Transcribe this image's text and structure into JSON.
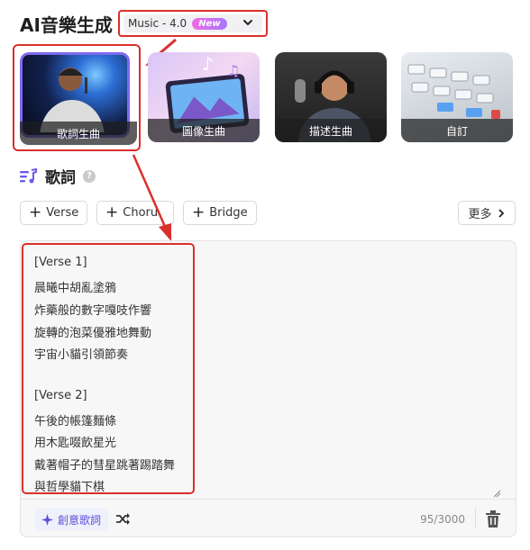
{
  "header": {
    "title": "AI音樂生成",
    "model_select": {
      "label": "Music - 4.0",
      "badge": "New"
    }
  },
  "modes": [
    {
      "label": "歌詞生曲",
      "selected": true
    },
    {
      "label": "圖像生曲",
      "selected": false
    },
    {
      "label": "描述生曲",
      "selected": false
    },
    {
      "label": "自訂",
      "selected": false
    }
  ],
  "lyrics_section": {
    "title": "歌詞",
    "help_icon": "?"
  },
  "chips": [
    {
      "label": "Verse"
    },
    {
      "label": "Choru"
    },
    {
      "label": "Bridge"
    }
  ],
  "more_label": "更多",
  "editor": {
    "lines": [
      "[Verse 1]",
      "晨曦中胡亂塗鴉",
      "炸藥般的數字嘎吱作響",
      "旋轉的泡菜優雅地舞動",
      "宇宙小貓引領節奏",
      "",
      "[Verse 2]",
      "午後的帳篷麵條",
      "用木匙啜飲星光",
      "戴著帽子的彗星跳著踢踏舞",
      "與哲學貓下棋"
    ],
    "char_count": "95/3000",
    "creative_button": "創意歌詞"
  },
  "colors": {
    "highlight_red": "#d9302c",
    "accent_purple": "#7d6af0",
    "new_badge_gradient": [
      "#f06ae4",
      "#a777ff"
    ]
  }
}
